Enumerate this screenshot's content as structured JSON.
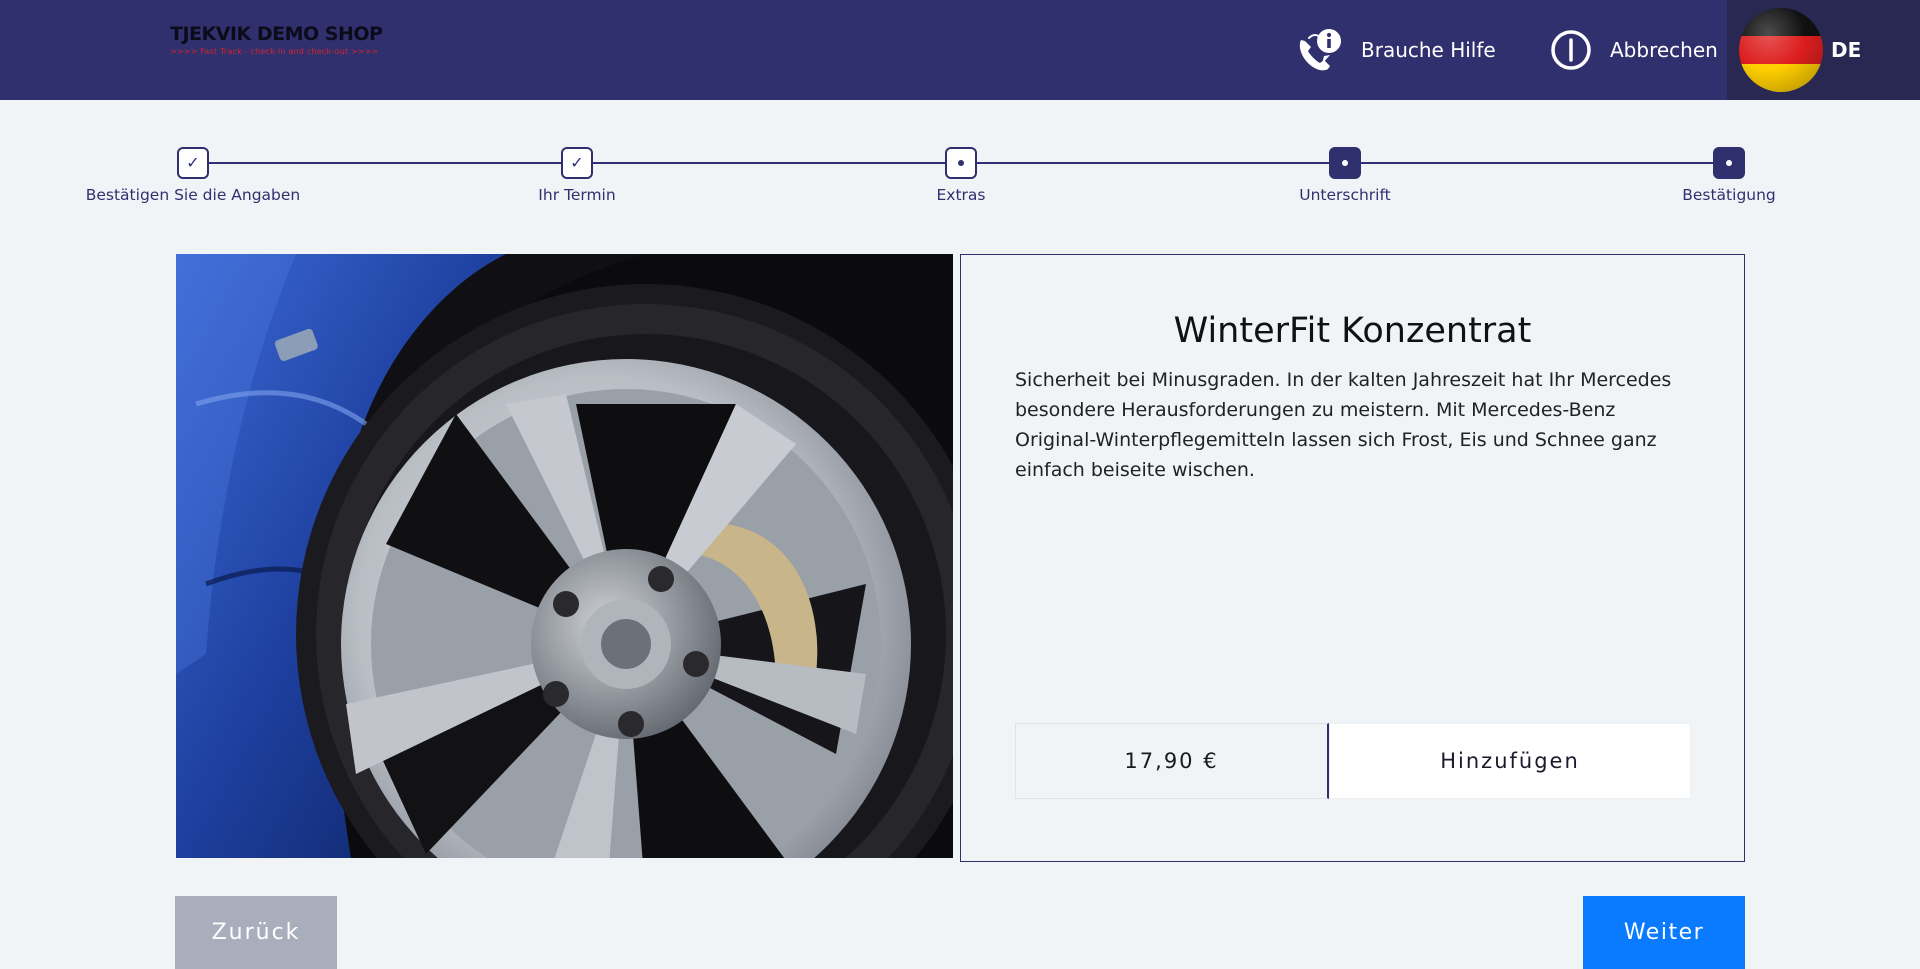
{
  "header": {
    "logo_title": "TJEKVIK DEMO SHOP",
    "logo_subtitle": ">>>> Fast Track - check-in and check-out >>>>",
    "help_label": "Brauche Hilfe",
    "cancel_label": "Abbrechen",
    "language_code": "DE"
  },
  "stepper": {
    "steps": [
      {
        "label": "Bestätigen Sie die Angaben",
        "state": "done",
        "symbol": "✓"
      },
      {
        "label": "Ihr Termin",
        "state": "done",
        "symbol": "✓"
      },
      {
        "label": "Extras",
        "state": "current",
        "symbol": "dot"
      },
      {
        "label": "Unterschrift",
        "state": "upcoming",
        "symbol": "dot"
      },
      {
        "label": "Bestätigung",
        "state": "upcoming",
        "symbol": "dot"
      }
    ]
  },
  "product": {
    "image_subject": "car-wheel-photo",
    "title": "WinterFit Konzentrat",
    "description": "Sicherheit bei Minusgraden. In der kalten Jahreszeit hat Ihr Mercedes besondere Herausforderungen zu meistern. Mit Mercedes-Benz Original-Winterpflegemitteln lassen sich Frost, Eis und Schnee ganz einfach beiseite wischen.",
    "price": "17,90 €",
    "add_label": "Hinzufügen"
  },
  "navigation": {
    "back_label": "Zurück",
    "next_label": "Weiter"
  },
  "colors": {
    "header_bg": "#31306f",
    "primary_button": "#0a7bff",
    "secondary_button": "#a9aebd",
    "page_bg": "#f1f4f7"
  }
}
